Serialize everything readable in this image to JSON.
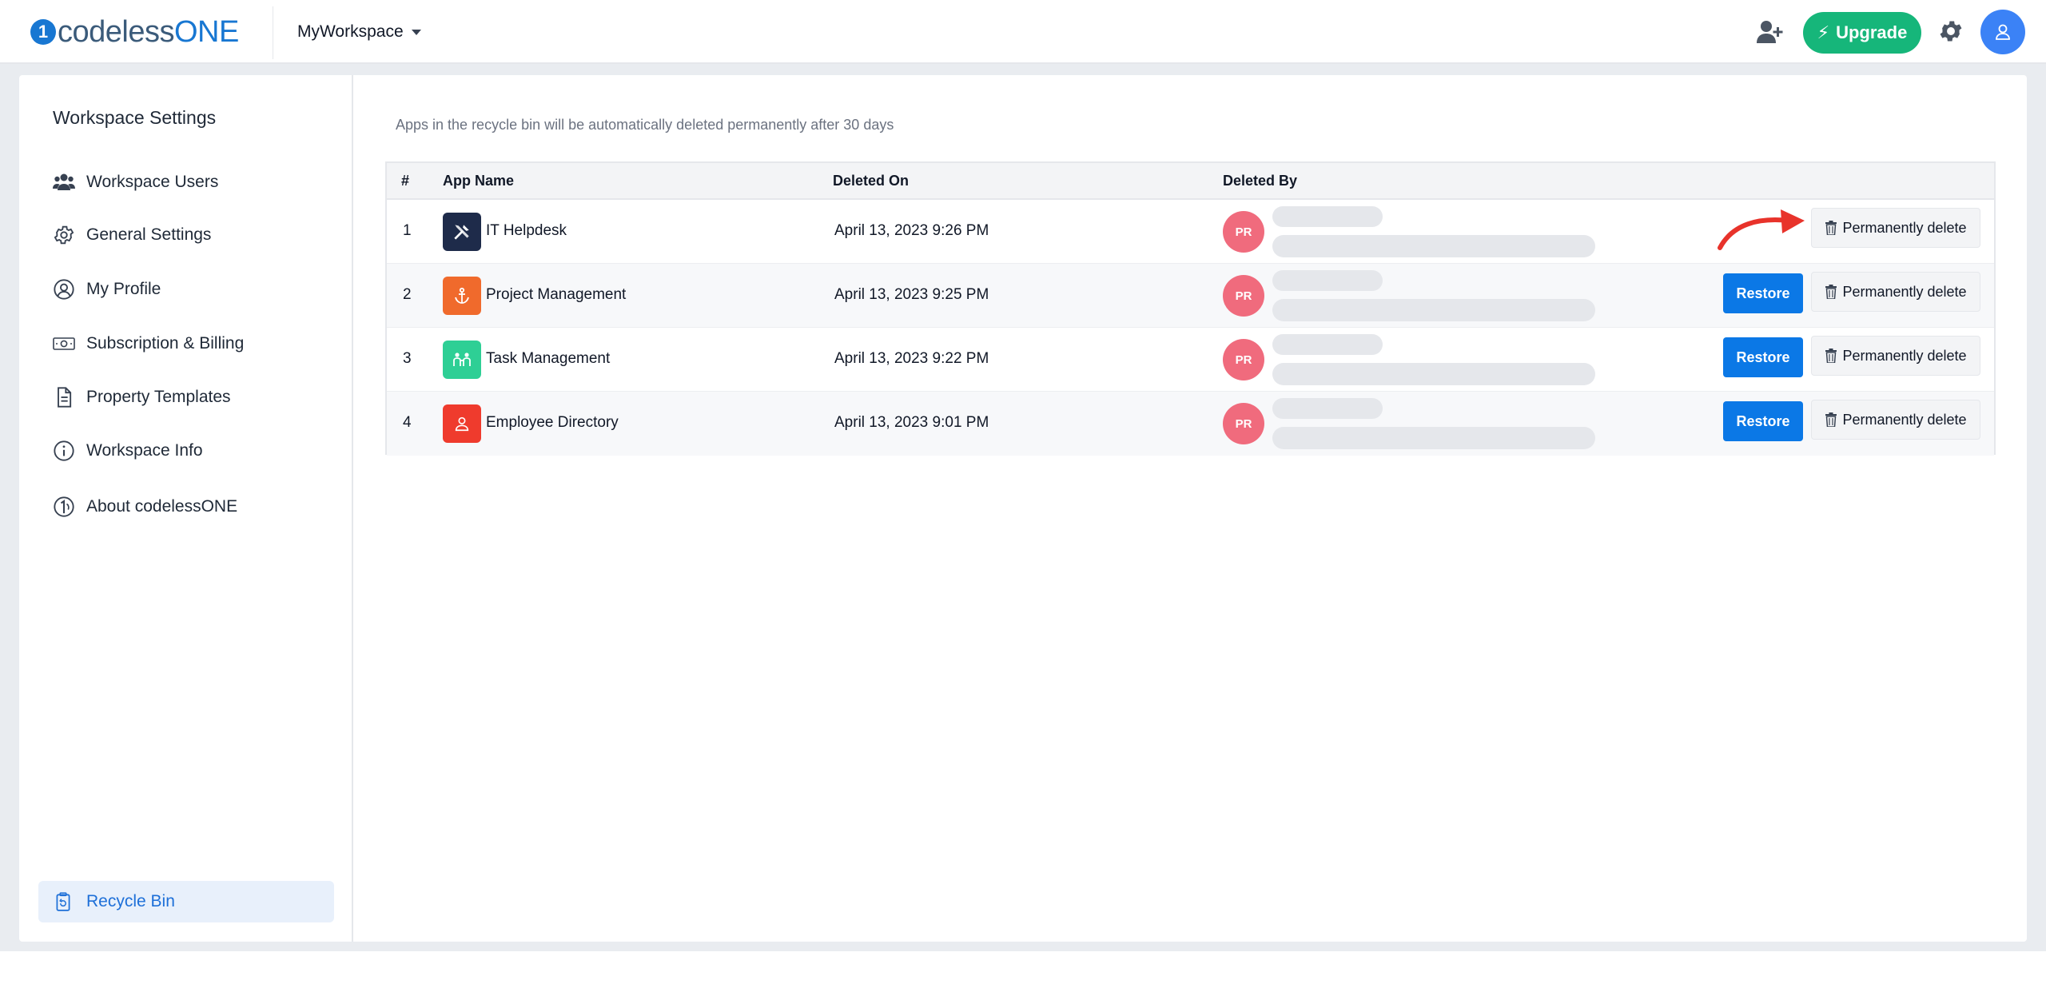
{
  "header": {
    "logo_mark": "1",
    "logo_text_dark": "codeless",
    "logo_text_accent": "ONE",
    "workspace_name": "MyWorkspace",
    "upgrade_label": "Upgrade",
    "icons": [
      "invite-user-icon",
      "lightning-icon",
      "gear-icon",
      "user-avatar-icon"
    ]
  },
  "sidebar": {
    "title": "Workspace Settings",
    "items": [
      {
        "label": "Workspace Users",
        "icon": "users-icon"
      },
      {
        "label": "General Settings",
        "icon": "gear-icon"
      },
      {
        "label": "My Profile",
        "icon": "profile-icon"
      },
      {
        "label": "Subscription & Billing",
        "icon": "billing-icon"
      },
      {
        "label": "Property Templates",
        "icon": "document-icon"
      },
      {
        "label": "Workspace Info",
        "icon": "info-icon"
      },
      {
        "label": "About codelessONE",
        "icon": "logo-icon"
      }
    ],
    "active_item": {
      "label": "Recycle Bin",
      "icon": "recycle-bin-icon"
    }
  },
  "main": {
    "notice": "Apps in the recycle bin will be automatically deleted permanently after 30 days",
    "columns": [
      "#",
      "App Name",
      "Deleted On",
      "Deleted By"
    ],
    "restore_label": "Restore",
    "delete_label": "Permanently delete",
    "rows": [
      {
        "num": "1",
        "app": "IT Helpdesk",
        "deleted_on": "April 13, 2023 9:26 PM",
        "deleted_by": "PR",
        "icon_color": "#1e2b4a",
        "icon": "tools-icon",
        "show_restore": false
      },
      {
        "num": "2",
        "app": "Project Management",
        "deleted_on": "April 13, 2023 9:25 PM",
        "deleted_by": "PR",
        "icon_color": "#f06a2c",
        "icon": "anchor-icon",
        "show_restore": true
      },
      {
        "num": "3",
        "app": "Task Management",
        "deleted_on": "April 13, 2023 9:22 PM",
        "deleted_by": "PR",
        "icon_color": "#2ecf95",
        "icon": "team-icon",
        "show_restore": true
      },
      {
        "num": "4",
        "app": "Employee Directory",
        "deleted_on": "April 13, 2023 9:01 PM",
        "deleted_by": "PR",
        "icon_color": "#ef3b2d",
        "icon": "person-icon",
        "show_restore": true
      }
    ]
  },
  "colors": {
    "accent": "#0b78e6",
    "upgrade": "#16b67a",
    "badge": "#f06b7d",
    "annotation_arrow": "#e8332b"
  }
}
